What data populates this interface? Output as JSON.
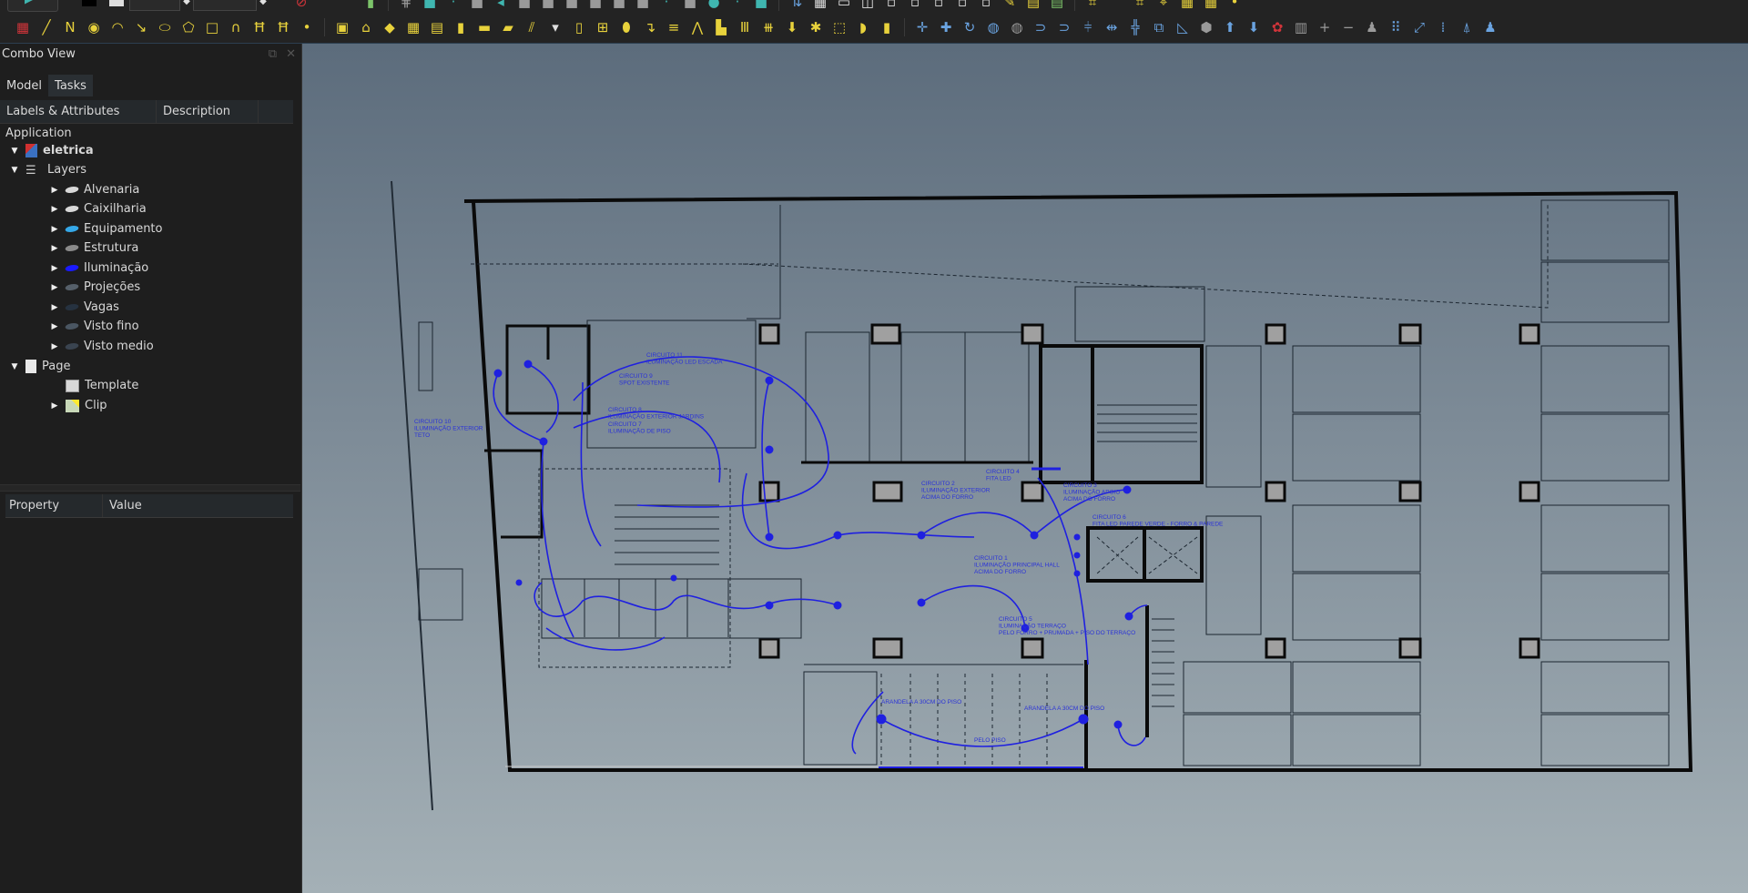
{
  "toolbar": {
    "row1_icons": [
      "workbench-selector",
      "color-black",
      "color-white",
      "linewidth-dropdown",
      "fontsize-dropdown",
      "no-entry",
      "battery-icon",
      "grid-icon",
      "view-btn-1",
      "view-btn-2",
      "view-btn-3",
      "view-btn-4",
      "view-btn-5",
      "view-btn-6",
      "view-btn-7",
      "view-btn-8",
      "view-btn-9"
    ],
    "draft_tools": [
      {
        "name": "draft-style-icon",
        "glyph": "▦"
      },
      {
        "name": "line-icon",
        "glyph": "╱"
      },
      {
        "name": "wire-icon",
        "glyph": "N"
      },
      {
        "name": "circle-icon",
        "glyph": "◉"
      },
      {
        "name": "arc-icon",
        "glyph": "◠"
      },
      {
        "name": "arc-3pt-icon",
        "glyph": "↘"
      },
      {
        "name": "ellipse-icon",
        "glyph": "⬭"
      },
      {
        "name": "polygon-icon",
        "glyph": "⬠"
      },
      {
        "name": "rectangle-icon",
        "glyph": "□"
      },
      {
        "name": "bezier-icon",
        "glyph": "∩"
      },
      {
        "name": "bspline-icon",
        "glyph": "Ħ"
      },
      {
        "name": "cubic-bezier-icon",
        "glyph": "Ħ"
      },
      {
        "name": "point-icon",
        "glyph": "•"
      }
    ],
    "arch_tools": [
      {
        "name": "arch-site-icon",
        "glyph": "▣"
      },
      {
        "name": "arch-building-icon",
        "glyph": "⌂"
      },
      {
        "name": "arch-floor-icon",
        "glyph": "◆"
      },
      {
        "name": "arch-buildingpart-icon",
        "glyph": "▦"
      },
      {
        "name": "arch-wall-icon",
        "glyph": "▤"
      },
      {
        "name": "arch-column-icon",
        "glyph": "▮"
      },
      {
        "name": "arch-beam-icon",
        "glyph": "▬"
      },
      {
        "name": "arch-slab-icon",
        "glyph": "▰"
      },
      {
        "name": "arch-truss-icon",
        "glyph": "⫽"
      },
      {
        "name": "arch-dropdown-icon",
        "glyph": "▾"
      },
      {
        "name": "arch-door-icon",
        "glyph": "▯"
      },
      {
        "name": "arch-window-icon",
        "glyph": "⊞"
      },
      {
        "name": "arch-pipe-icon",
        "glyph": "⬮"
      },
      {
        "name": "arch-pipe-connector-icon",
        "glyph": "↴"
      },
      {
        "name": "arch-stairs-icon",
        "glyph": "≡"
      },
      {
        "name": "arch-roof-icon",
        "glyph": "⋀"
      },
      {
        "name": "arch-panel-icon",
        "glyph": "▙"
      },
      {
        "name": "arch-frame-icon",
        "glyph": "Ⅲ"
      },
      {
        "name": "arch-fence-icon",
        "glyph": "⧻"
      },
      {
        "name": "arch-equipment-icon",
        "glyph": "⬇"
      },
      {
        "name": "arch-component-icon",
        "glyph": "✱"
      },
      {
        "name": "arch-reference-icon",
        "glyph": "⬚"
      },
      {
        "name": "arch-cutplane-icon",
        "glyph": "◗"
      },
      {
        "name": "arch-material-icon",
        "glyph": "▮"
      }
    ],
    "mod_tools": [
      {
        "name": "move-icon",
        "glyph": "✛"
      },
      {
        "name": "add-icon",
        "glyph": "✚"
      },
      {
        "name": "rotate-icon",
        "glyph": "↻"
      },
      {
        "name": "offset-icon",
        "glyph": "◍"
      },
      {
        "name": "join-icon",
        "glyph": "◍"
      },
      {
        "name": "split-icon",
        "glyph": "⊃"
      },
      {
        "name": "upgrade-icon",
        "glyph": "⊃"
      },
      {
        "name": "trimex-icon",
        "glyph": "⫩"
      },
      {
        "name": "stretch-icon",
        "glyph": "⇹"
      },
      {
        "name": "array-icon",
        "glyph": "╬"
      },
      {
        "name": "clone-icon",
        "glyph": "⧉"
      },
      {
        "name": "mirror-icon",
        "glyph": "◺"
      },
      {
        "name": "shape2dview-icon",
        "glyph": "⬢"
      },
      {
        "name": "upgrade-arrow-icon",
        "glyph": "⬆"
      },
      {
        "name": "downgrade-arrow-icon",
        "glyph": "⬇"
      },
      {
        "name": "remove-icon",
        "glyph": "✿"
      },
      {
        "name": "subtract-icon",
        "glyph": "▥"
      },
      {
        "name": "plus-icon",
        "glyph": "+"
      },
      {
        "name": "minus-icon",
        "glyph": "−"
      },
      {
        "name": "survey-icon",
        "glyph": "♟"
      },
      {
        "name": "grid-array-icon",
        "glyph": "⠿"
      },
      {
        "name": "path-array-icon",
        "glyph": "⤢"
      },
      {
        "name": "point-array-icon",
        "glyph": "⁞"
      },
      {
        "name": "wp-proxy-icon",
        "glyph": "⍋"
      },
      {
        "name": "facebinder-icon",
        "glyph": "♟"
      }
    ]
  },
  "combo_view": {
    "title": "Combo View",
    "tabs": [
      {
        "label": "Model",
        "active": true
      },
      {
        "label": "Tasks",
        "active": false
      }
    ],
    "tree_columns": [
      "Labels & Attributes",
      "Description"
    ],
    "tree": [
      {
        "label": "Application",
        "indent": 0,
        "arrow": "",
        "icon": "none",
        "bold": false
      },
      {
        "label": "eletrica",
        "indent": 0,
        "arrow": "down",
        "icon": "document",
        "bold": true
      },
      {
        "label": "Layers",
        "indent": 1,
        "arrow": "down",
        "icon": "layers",
        "bold": false
      },
      {
        "label": "Alvenaria",
        "indent": 2,
        "arrow": "right",
        "icon": "layer",
        "color": "#d8d8d8",
        "bold": false
      },
      {
        "label": "Caixilharia",
        "indent": 2,
        "arrow": "right",
        "icon": "layer",
        "color": "#d8d8d8",
        "bold": false
      },
      {
        "label": "Equipamento",
        "indent": 2,
        "arrow": "right",
        "icon": "layer",
        "color": "#35a8e8",
        "bold": false
      },
      {
        "label": "Estrutura",
        "indent": 2,
        "arrow": "right",
        "icon": "layer",
        "color": "#8a8a8a",
        "bold": false
      },
      {
        "label": "Iluminação",
        "indent": 2,
        "arrow": "right",
        "icon": "layer",
        "color": "#1a1aff",
        "bold": false
      },
      {
        "label": "Projeções",
        "indent": 2,
        "arrow": "right",
        "icon": "layer",
        "color": "#56606a",
        "bold": false
      },
      {
        "label": "Vagas",
        "indent": 2,
        "arrow": "right",
        "icon": "layer",
        "color": "#263240",
        "bold": false
      },
      {
        "label": "Visto fino",
        "indent": 2,
        "arrow": "right",
        "icon": "layer",
        "color": "#4a5662",
        "bold": false
      },
      {
        "label": "Visto medio",
        "indent": 2,
        "arrow": "right",
        "icon": "layer",
        "color": "#3a4450",
        "bold": false
      },
      {
        "label": "Page",
        "indent": 1,
        "arrow": "down",
        "icon": "page",
        "bold": false
      },
      {
        "label": "Template",
        "indent": 2,
        "arrow": "",
        "icon": "template",
        "bold": false
      },
      {
        "label": "Clip",
        "indent": 2,
        "arrow": "right",
        "icon": "clip",
        "bold": false
      }
    ],
    "property_columns": [
      "Property",
      "Value"
    ]
  },
  "drawing": {
    "annotations": [
      {
        "lines": [
          "CIRCUITO 11",
          "ILUMINAÇÃO LED ESCADA"
        ]
      },
      {
        "lines": [
          "CIRCUITO 9",
          "SPOT EXISTENTE"
        ]
      },
      {
        "lines": [
          "CIRCUITO 8",
          "ILUMINAÇÃO EXTERIOR JARDINS"
        ]
      },
      {
        "lines": [
          "CIRCUITO 7",
          "ILUMINAÇÃO DE PISO"
        ]
      },
      {
        "lines": [
          "CIRCUITO 10",
          "ILUMINAÇÃO EXTERIOR",
          "TETO"
        ]
      },
      {
        "lines": [
          "CIRCUITO 2",
          "ILUMINAÇÃO EXTERIOR",
          "ACIMA DO FORRO"
        ]
      },
      {
        "lines": [
          "CIRCUITO 4",
          "FITA LED"
        ]
      },
      {
        "lines": [
          "CIRCUITO 3",
          "ILUMINAÇÃO APOIO",
          "ACIMA DO FORRO"
        ]
      },
      {
        "lines": [
          "CIRCUITO 6",
          "FITA LED PAREDE VERDE - FORRO & PAREDE"
        ]
      },
      {
        "lines": [
          "CIRCUITO 1",
          "ILUMINAÇÃO PRINCIPAL HALL",
          "ACIMA DO FORRO"
        ]
      },
      {
        "lines": [
          "CIRCUITO 5",
          "ILUMINAÇÃO TERRAÇO",
          "PELO FORRO + PRUMADA + PISO DO TERRAÇO"
        ]
      },
      {
        "lines": [
          "ARANDELA A 30CM DO PISO"
        ]
      },
      {
        "lines": [
          "ARANDELA A 30CM DO PISO"
        ]
      },
      {
        "lines": [
          "PELO PISO"
        ]
      }
    ]
  }
}
